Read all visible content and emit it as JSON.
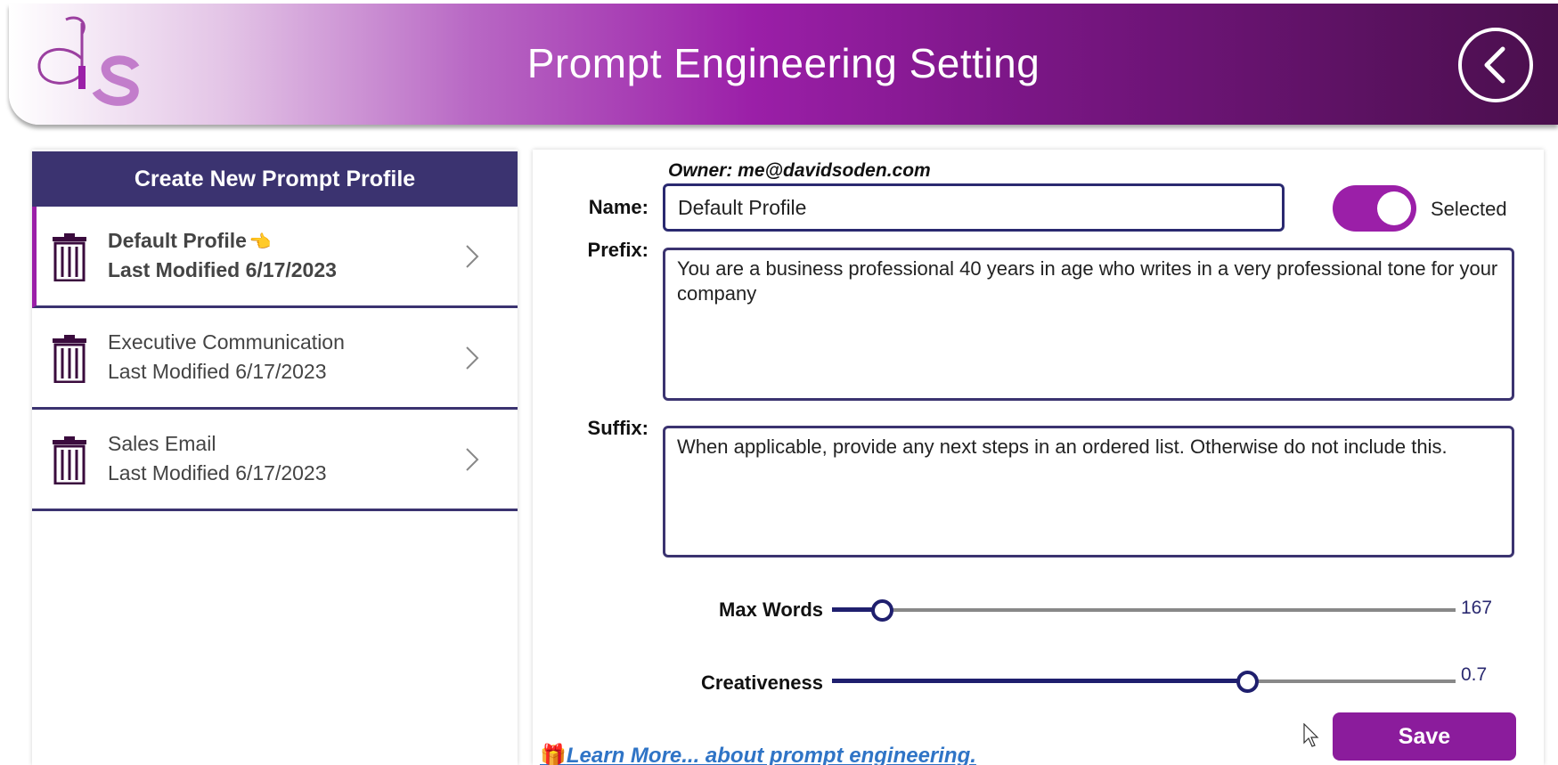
{
  "header": {
    "title": "Prompt Engineering Setting",
    "logo_icon": "ds-logo",
    "back_icon": "chevron-left-circle-icon",
    "gradient": [
      "#ffffff",
      "#9b1fa8",
      "#4a0f4d"
    ]
  },
  "sidebar": {
    "create_label": "Create New Prompt Profile",
    "items": [
      {
        "name": "Default Profile",
        "emoji": "👈",
        "modified": "Last Modified 6/17/2023",
        "selected": true
      },
      {
        "name": "Executive Communication",
        "emoji": "",
        "modified": "Last Modified 6/17/2023",
        "selected": false
      },
      {
        "name": "Sales Email",
        "emoji": "",
        "modified": "Last Modified 6/17/2023",
        "selected": false
      }
    ]
  },
  "form": {
    "owner": "Owner: me@davidsoden.com",
    "name_label": "Name:",
    "name_value": "Default Profile",
    "toggle_label": "Selected",
    "toggle_on": true,
    "prefix_label": "Prefix:",
    "prefix_value": "You are a business professional 40 years in age who writes in a very professional tone for your company",
    "suffix_label": "Suffix:",
    "suffix_value": "When applicable, provide any next steps in an ordered list. Otherwise do not include this.",
    "max_words": {
      "label": "Max Words",
      "value": "167",
      "fraction": 0.08
    },
    "creativeness": {
      "label": "Creativeness",
      "value": "0.7",
      "fraction": 0.665
    },
    "learn_more": "Learn More... about prompt engineering.",
    "gift_icon": "🎁",
    "save_label": "Save"
  },
  "colors": {
    "primary_purple": "#9b1fa8",
    "navy": "#3b3370",
    "link_blue": "#2f74c6"
  }
}
